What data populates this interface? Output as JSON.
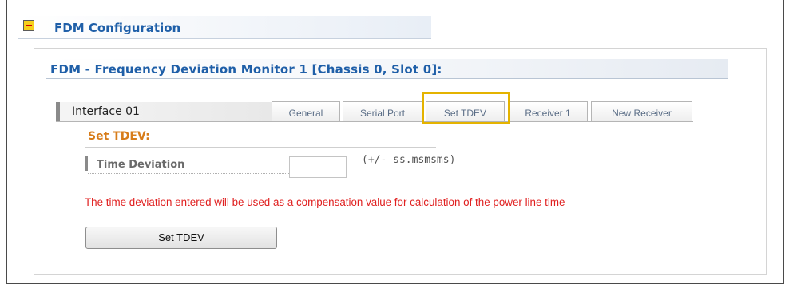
{
  "section": {
    "title": "FDM Configuration",
    "collapse_icon": "minus-box-icon"
  },
  "panel": {
    "title": "FDM - Frequency Deviation Monitor 1 [Chassis 0, Slot 0]:"
  },
  "interface": {
    "label": "Interface 01"
  },
  "tabs": [
    {
      "label": "General"
    },
    {
      "label": "Serial Port"
    },
    {
      "label": "Set TDEV",
      "selected": true
    },
    {
      "label": "Receiver 1"
    },
    {
      "label": "New Receiver"
    }
  ],
  "form": {
    "heading": "Set TDEV:",
    "field_label": "Time Deviation",
    "field_value": "",
    "field_hint": "(+/- ss.msmsms)",
    "note": "The time deviation entered will be used as a compensation value for calculation of the power line time",
    "button_label": "Set TDEV"
  },
  "colors": {
    "heading_blue": "#1f5fa8",
    "subheading_orange": "#d77c1a",
    "note_red": "#e02020",
    "highlight_yellow": "#e4b300"
  }
}
